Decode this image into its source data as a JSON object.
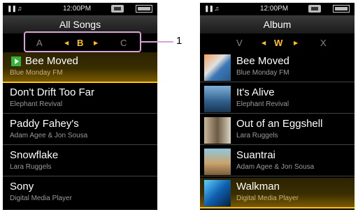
{
  "status": {
    "time": "12:00PM"
  },
  "all_songs": {
    "title": "All Songs",
    "index": {
      "prev": "A",
      "current": "B",
      "next": "C"
    },
    "items": [
      {
        "title": "Bee Moved",
        "artist": "Blue Monday FM",
        "selected": true,
        "playing": true
      },
      {
        "title": "Don't Drift Too Far",
        "artist": "Elephant Revival"
      },
      {
        "title": "Paddy Fahey's",
        "artist": "Adam Agee & Jon Sousa"
      },
      {
        "title": "Snowflake",
        "artist": "Lara Ruggels"
      },
      {
        "title": "Sony",
        "artist": "Digital Media Player"
      }
    ]
  },
  "album": {
    "title": "Album",
    "index": {
      "prev": "V",
      "current": "W",
      "next": "X"
    },
    "items": [
      {
        "title": "Bee Moved",
        "artist": "Blue Monday FM"
      },
      {
        "title": "It's Alive",
        "artist": "Elephant Revival"
      },
      {
        "title": "Out of an Eggshell",
        "artist": "Lara Ruggels"
      },
      {
        "title": "Suantrai",
        "artist": "Adam Agee & Jon Sousa"
      },
      {
        "title": "Walkman",
        "artist": "Digital Media Player",
        "selected": true
      }
    ]
  },
  "callout": {
    "label": "1"
  }
}
